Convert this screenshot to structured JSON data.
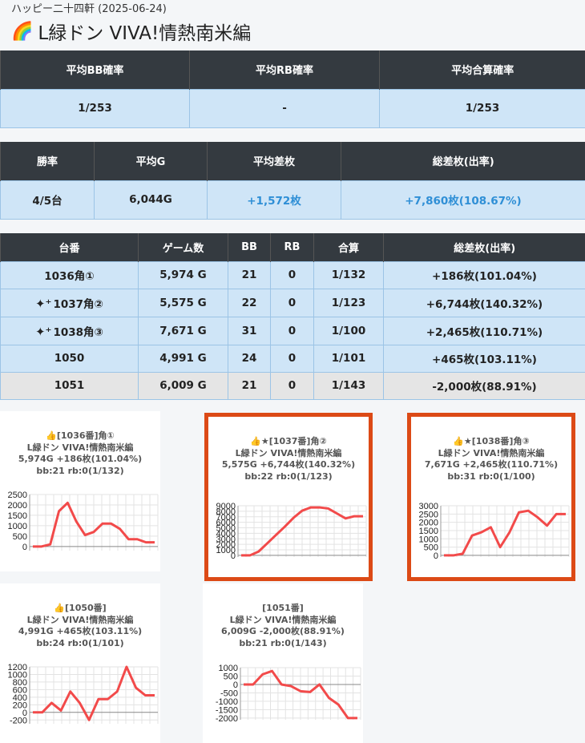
{
  "header": {
    "breadcrumb": "ハッピー二十四軒 (2025-06-24)",
    "title": "L緑ドン VIVA!情熱南米編"
  },
  "summary1": {
    "headers": [
      "平均BB確率",
      "平均RB確率",
      "平均合算確率"
    ],
    "values": [
      "1/253",
      "-",
      "1/253"
    ]
  },
  "summary2": {
    "headers": [
      "勝率",
      "平均G",
      "平均差枚",
      "総差枚(出率)"
    ],
    "values": [
      "4/5台",
      "6,044G",
      "+1,572枚",
      "+7,860枚(108.67%)"
    ]
  },
  "machines": {
    "headers": [
      "台番",
      "ゲーム数",
      "BB",
      "RB",
      "合算",
      "総差枚(出率)"
    ],
    "rows": [
      {
        "id": "1036角①",
        "games": "5,974 G",
        "bb": "21",
        "rb": "0",
        "total": "1/132",
        "diff": "+186枚(101.04%)",
        "sparkle": false
      },
      {
        "id": "1037角②",
        "games": "5,575 G",
        "bb": "22",
        "rb": "0",
        "total": "1/123",
        "diff": "+6,744枚(140.32%)",
        "sparkle": true
      },
      {
        "id": "1038角③",
        "games": "7,671 G",
        "bb": "31",
        "rb": "0",
        "total": "1/100",
        "diff": "+2,465枚(110.71%)",
        "sparkle": true
      },
      {
        "id": "1050",
        "games": "4,991 G",
        "bb": "24",
        "rb": "0",
        "total": "1/101",
        "diff": "+465枚(103.11%)",
        "sparkle": false
      },
      {
        "id": "1051",
        "games": "6,009 G",
        "bb": "21",
        "rb": "0",
        "total": "1/143",
        "diff": "-2,000枚(88.91%)",
        "sparkle": false
      }
    ]
  },
  "chart_data": [
    {
      "type": "line",
      "caption": [
        "👍[1036番]角①",
        "L緑ドン VIVA!情熱南米編",
        "5,974G +186枚(101.04%)",
        "bb:21 rb:0(1/132)"
      ],
      "yticks": [
        2500,
        2000,
        1500,
        1000,
        500,
        0
      ],
      "ylim": [
        -200,
        2500
      ],
      "values": [
        0,
        0,
        100,
        1700,
        2100,
        1200,
        550,
        700,
        1100,
        1100,
        850,
        350,
        350,
        200,
        200
      ],
      "highlighted": false,
      "color": "#f24a4a"
    },
    {
      "type": "line",
      "caption": [
        "👍★[1037番]角②",
        "L緑ドン VIVA!情熱南米編",
        "5,575G +6,744枚(140.32%)",
        "bb:22 rb:0(1/123)"
      ],
      "yticks": [
        9000,
        8000,
        7000,
        6000,
        5000,
        4000,
        3000,
        2000,
        1000,
        0
      ],
      "ylim": [
        -300,
        9000
      ],
      "values": [
        0,
        0,
        700,
        2200,
        3700,
        5200,
        6800,
        8100,
        8700,
        8700,
        8500,
        7600,
        6700,
        7100,
        7100
      ],
      "highlighted": true,
      "color": "#f24a4a"
    },
    {
      "type": "line",
      "caption": [
        "👍★[1038番]角③",
        "L緑ドン VIVA!情熱南米編",
        "7,671G +2,465枚(110.71%)",
        "bb:31 rb:0(1/100)"
      ],
      "yticks": [
        3000,
        2500,
        2000,
        1500,
        1000,
        500,
        0
      ],
      "ylim": [
        -100,
        3000
      ],
      "values": [
        0,
        0,
        100,
        1200,
        1400,
        1700,
        500,
        1400,
        2600,
        2700,
        2300,
        1800,
        2500,
        2500
      ],
      "highlighted": true,
      "color": "#f24a4a"
    },
    {
      "type": "line",
      "caption": [
        "👍[1050番]",
        "L緑ドン VIVA!情熱南米編",
        "4,991G +465枚(103.11%)",
        "bb:24 rb:0(1/101)"
      ],
      "yticks": [
        1200,
        1000,
        800,
        600,
        400,
        200,
        0,
        -200
      ],
      "ylim": [
        -300,
        1200
      ],
      "values": [
        0,
        0,
        250,
        50,
        550,
        250,
        -200,
        350,
        350,
        550,
        1200,
        650,
        450,
        450
      ],
      "highlighted": false,
      "color": "#f24a4a"
    },
    {
      "type": "line",
      "caption": [
        "[1051番]",
        "L緑ドン VIVA!情熱南米編",
        "6,009G -2,000枚(88.91%)",
        "bb:21 rb:0(1/143)"
      ],
      "yticks": [
        1000,
        500,
        0,
        -500,
        -1000,
        -1500,
        -2000
      ],
      "ylim": [
        -2100,
        1000
      ],
      "values": [
        0,
        0,
        600,
        800,
        0,
        -100,
        -400,
        -450,
        0,
        -800,
        -1200,
        -2000,
        -2000
      ],
      "highlighted": false,
      "color": "#f24a4a"
    }
  ]
}
